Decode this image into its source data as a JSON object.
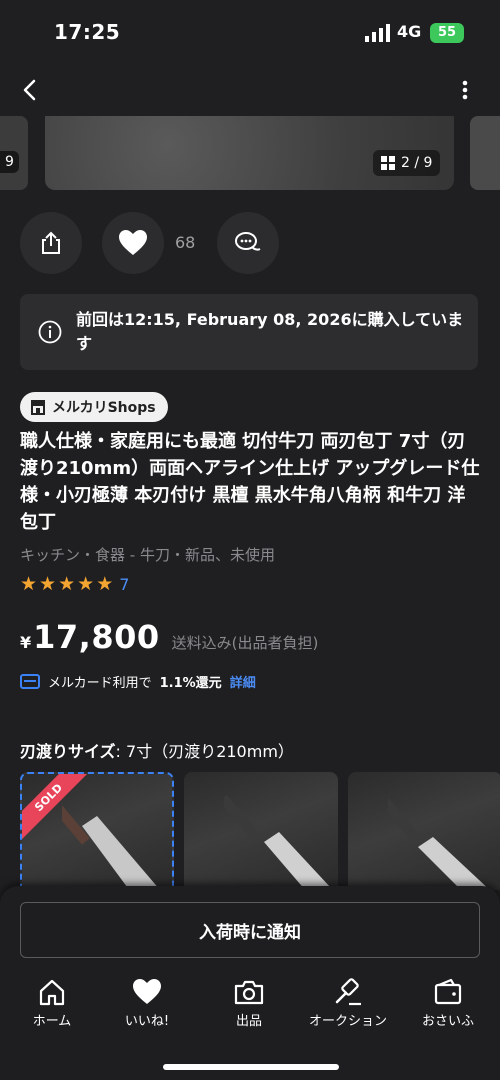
{
  "status_bar": {
    "time": "17:25",
    "network": "4G",
    "battery": "55"
  },
  "carousel": {
    "left_counter": "9",
    "counter": "2 / 9"
  },
  "actions": {
    "like_count": "68"
  },
  "notice": {
    "text": "前回は12:15, February 08, 2026に購入しています"
  },
  "shop_badge": {
    "label": "メルカリShops"
  },
  "item": {
    "title": "職人仕様・家庭用にも最適 切付牛刀 両刃包丁 7寸（刃渡り210mm）両面ヘアライン仕上げ アップグレード仕様・小刃極薄 本刃付け 黒檀 黒水牛角八角柄 和牛刀 洋包丁",
    "category": "キッチン・食器 - 牛刀・新品、未使用",
    "rating_count": "7",
    "rating_stars": 5,
    "price_symbol": "¥",
    "price": "17,800",
    "shipping": "送料込み(出品者負担)"
  },
  "card_promo": {
    "prefix": "メルカード利用で",
    "rate": "1.1%還元",
    "link": "詳細"
  },
  "variant": {
    "label": "刃渡りサイズ",
    "value": ": 7寸（刃渡り210mm）",
    "sold_label": "SOLD"
  },
  "notify_button": {
    "label": "入荷時に通知"
  },
  "tabs": [
    {
      "label": "ホーム",
      "icon": "home-icon"
    },
    {
      "label": "いいね!",
      "icon": "heart-icon"
    },
    {
      "label": "出品",
      "icon": "camera-icon"
    },
    {
      "label": "オークション",
      "icon": "gavel-icon"
    },
    {
      "label": "おさいふ",
      "icon": "wallet-icon"
    }
  ],
  "colors": {
    "accent_blue": "#4b8cf5",
    "star": "#f2a531",
    "sold": "#e8455a",
    "battery": "#3dc85b"
  }
}
